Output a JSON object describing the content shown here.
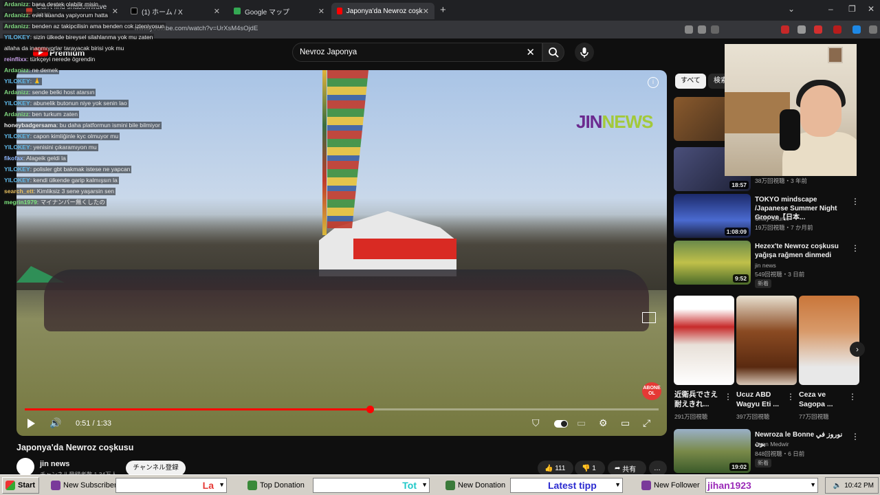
{
  "browser": {
    "tabs": [
      {
        "label": "Can't find shadowwave scan",
        "fav": "#c0392b"
      },
      {
        "label": "(1) ホーム / X",
        "fav": "#000000"
      },
      {
        "label": "Google マップ",
        "fav": "#34a853"
      },
      {
        "label": "Japonya'da Newroz coşkusu - Y",
        "fav": "#ff0000"
      }
    ],
    "new_tab": "+",
    "url": "www.youtube.com/watch?v=UrXsM4sOjdE"
  },
  "youtube": {
    "logo_text": "Premium",
    "search_value": "Nevroz Japonya",
    "video": {
      "watermark_jin": "JIN",
      "watermark_news": "NEWS",
      "abone": "ABONE OL",
      "time": "0:51 / 1:33",
      "progress": 0.545
    },
    "title": "Japonya'da Newroz coşkusu",
    "channel": "jin news",
    "channel_subs": "チャンネル登録者数 1.34万人",
    "subscribe": "チャンネル登録",
    "likes": "111",
    "dislikes": "1",
    "share": "共有",
    "more": "…"
  },
  "sidebar": {
    "chips": [
      "すべて",
      "検索"
    ],
    "videos": [
      {
        "title": "",
        "meta": "",
        "duration": "",
        "thumb": "#6b4a2d"
      },
      {
        "title": "",
        "meta": "38万回視聴・3 年前",
        "duration": "18:57",
        "thumb": "#3a3f5a"
      },
      {
        "title": "TOKYO mindscape /Japanese Summer Night Groove【日本...",
        "channel": "Chilly Source",
        "meta": "19万回視聴・7 か月前",
        "duration": "1:08:09",
        "thumb": "#2a4a8f"
      },
      {
        "title": "Hezex'te Newroz coşkusu yağışa rağmen dinmedi",
        "channel": "jin news",
        "meta": "549回視聴・3 日前",
        "badge": "新着",
        "duration": "9:52",
        "thumb": "#5a7a3a"
      }
    ],
    "shorts": [
      {
        "title": "近衛兵でさえ耐えきれ...",
        "views": "291万回視聴",
        "thumb": "#d9dde8"
      },
      {
        "title": "Ucuz ABD Wagyu Eti ...",
        "views": "397万回視聴",
        "thumb": "#7a4a2a"
      },
      {
        "title": "Ceza ve Sagopa ...",
        "views": "77万回視聴",
        "thumb": "#c96a4a"
      }
    ],
    "last": {
      "title": "Newroza le Bonne نوروز في بون",
      "channel": "Jwan Medwir",
      "meta": "848回視聴・6 日前",
      "badge": "新着",
      "duration": "19:02"
    }
  },
  "chat": [
    {
      "user": "Ardanizz",
      "msg": "bana destek olabilir misin",
      "color": "#7fd67f"
    },
    {
      "user": "Ardanizz",
      "msg": "evet suanda yapiyorum hatta",
      "color": "#7fd67f"
    },
    {
      "user": "Ardanizz",
      "msg": "benden az takipcilisin ama benden cok izleniyosun",
      "color": "#7fd67f"
    },
    {
      "user": "YILOKEY",
      "msg": "sizin ülkede bireysel silahlanma yok mu zaten",
      "color": "#5fb8e8"
    },
    {
      "user": "",
      "msg": "allaha da inanmıyorlar tarayacak birisi yok mu",
      "color": "#e8e8e8"
    },
    {
      "user": "reinflixx",
      "msg": "türkçeyi nerede ögrendin",
      "color": "#c7a0e8"
    },
    {
      "user": "Ardanizz",
      "msg": "ne demek",
      "color": "#7fd67f"
    },
    {
      "user": "YILOKEY",
      "msg": "🙏",
      "color": "#5fb8e8"
    },
    {
      "user": "Ardanizz",
      "msg": "sende belki host atarsın",
      "color": "#7fd67f"
    },
    {
      "user": "YILOKEY",
      "msg": "abunelik butonun niye yok senin lao",
      "color": "#5fb8e8"
    },
    {
      "user": "Ardanizz",
      "msg": "ben turkum zaten",
      "color": "#7fd67f"
    },
    {
      "user": "honeybadgersama",
      "msg": "bu daha platformun ismini bile bilmiyor",
      "color": "#e8e8e8"
    },
    {
      "user": "YILOKEY",
      "msg": "capon kimliğinle kyc olmuyor mu",
      "color": "#5fb8e8"
    },
    {
      "user": "YILOKEY",
      "msg": "yenisini çıkaramıyon mu",
      "color": "#5fb8e8"
    },
    {
      "user": "fikofax",
      "msg": "Alageik geldi la",
      "color": "#8fb8ff"
    },
    {
      "user": "YILOKEY",
      "msg": "polisler gbt bakmak istese ne yapcan",
      "color": "#5fb8e8"
    },
    {
      "user": "YILOKEY",
      "msg": "kendi ülkende garip kalmışsın la",
      "color": "#5fb8e8"
    },
    {
      "user": "search_ett",
      "msg": "Kimliksiz 3 sene yaşarsin sen",
      "color": "#e8c060"
    },
    {
      "user": "megrin1979",
      "msg": "マイナンバー無くしたの",
      "color": "#7fe87f"
    }
  ],
  "taskbar": {
    "start": "Start",
    "new_subscriber": "New Subscriber",
    "ticker1": "La",
    "top_donation": "Top Donation",
    "ticker2": "Tot",
    "new_donation": "New Donation",
    "latest_tipp": "Latest tipp",
    "new_follower": "New Follower",
    "follower_name": "jihan1923",
    "clock": "10:42 PM"
  }
}
